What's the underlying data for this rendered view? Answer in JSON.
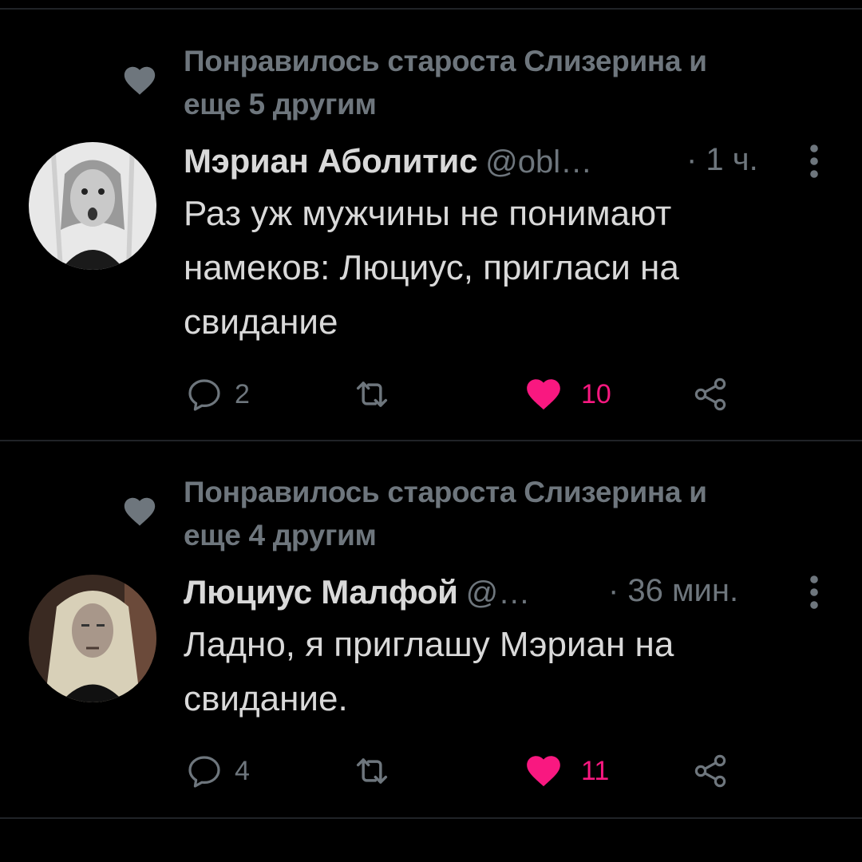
{
  "tweets": [
    {
      "liked_by": "Понравилось староста Слизерина и",
      "liked_by_2": "еще 5 другим",
      "name": "Мэриан Аболитис",
      "handle": "@obl…",
      "time": "· 1 ч.",
      "text_lines": [
        "Раз уж мужчины не понимают",
        "намеков: Люциус, пригласи на",
        "свидание"
      ],
      "replies": "2",
      "likes": "10",
      "avatar_icon": "woman-photo"
    },
    {
      "liked_by": "Понравилось староста Слизерина и",
      "liked_by_2": "еще 4 другим",
      "name": "Люциус Малфой",
      "handle": "@…",
      "time": "· 36 мин.",
      "text_lines": [
        "Ладно, я приглашу Мэриан на",
        "свидание."
      ],
      "replies": "4",
      "likes": "11",
      "avatar_icon": "man-long-blond-hair-photo"
    }
  ],
  "colors": {
    "background": "#000000",
    "text": "#d9d9d9",
    "secondary": "#6e767d",
    "like": "#f91880",
    "divider": "#202327"
  },
  "icons": [
    "heart-icon",
    "reply-icon",
    "retweet-icon",
    "like-icon",
    "share-icon",
    "more-icon"
  ]
}
